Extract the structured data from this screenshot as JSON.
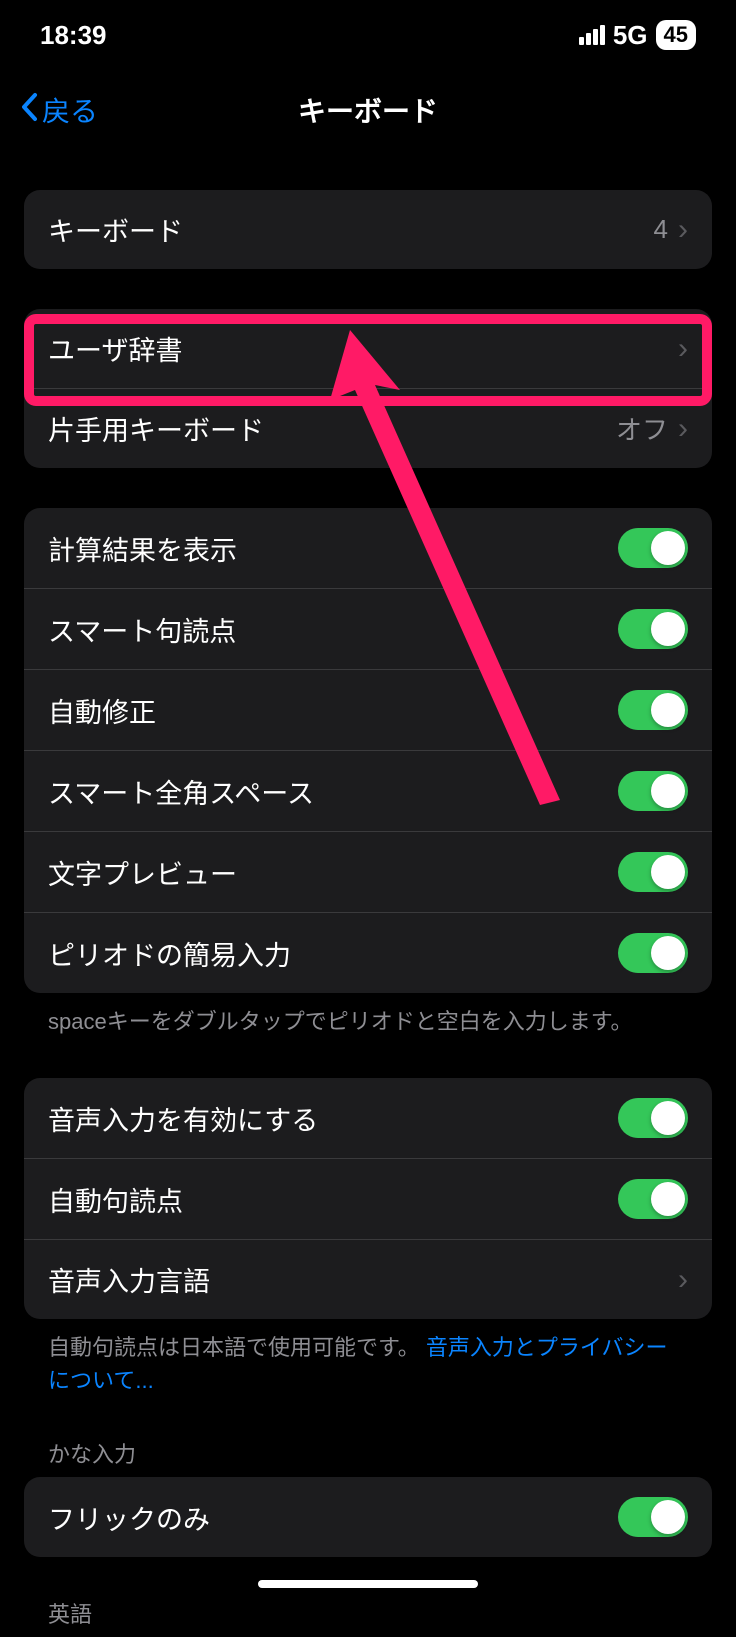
{
  "status": {
    "time": "18:39",
    "network": "5G",
    "battery": "45"
  },
  "nav": {
    "back": "戻る",
    "title": "キーボード"
  },
  "group1": {
    "row0": {
      "label": "キーボード",
      "value": "4"
    }
  },
  "group2": {
    "row0": {
      "label": "ユーザ辞書"
    },
    "row1": {
      "label": "片手用キーボード",
      "value": "オフ"
    }
  },
  "group3": {
    "row0": {
      "label": "計算結果を表示"
    },
    "row1": {
      "label": "スマート句読点"
    },
    "row2": {
      "label": "自動修正"
    },
    "row3": {
      "label": "スマート全角スペース"
    },
    "row4": {
      "label": "文字プレビュー"
    },
    "row5": {
      "label": "ピリオドの簡易入力"
    },
    "footer": "spaceキーをダブルタップでピリオドと空白を入力します。"
  },
  "group4": {
    "row0": {
      "label": "音声入力を有効にする"
    },
    "row1": {
      "label": "自動句読点"
    },
    "row2": {
      "label": "音声入力言語"
    },
    "footer_pre": "自動句読点は日本語で使用可能です。 ",
    "footer_link": "音声入力とプライバシーについて..."
  },
  "section_kana": "かな入力",
  "group5": {
    "row0": {
      "label": "フリックのみ"
    }
  },
  "section_en": "英語"
}
